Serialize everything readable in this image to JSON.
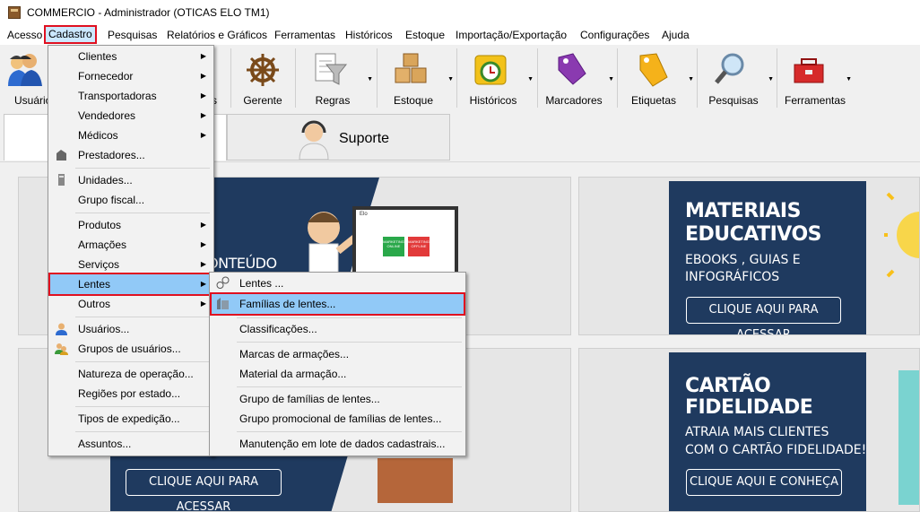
{
  "window": {
    "title": "COMMERCIO - Administrador (OTICAS ELO TM1)"
  },
  "menubar": {
    "items": [
      "Acesso",
      "Cadastro",
      "Pesquisas",
      "Relatórios e Gráficos",
      "Ferramentas",
      "Históricos",
      "Estoque",
      "Importação/Exportação",
      "Configurações",
      "Ajuda"
    ]
  },
  "toolbar": {
    "items": [
      {
        "label": "Usuários",
        "icon": "users-icon"
      },
      {
        "label": "Gerente",
        "icon": "ship-wheel-icon"
      },
      {
        "label": "Regras",
        "icon": "funnel-icon"
      },
      {
        "label": "Estoque",
        "icon": "boxes-icon"
      },
      {
        "label": "Históricos",
        "icon": "history-clock-icon"
      },
      {
        "label": "Marcadores",
        "icon": "tag-icon"
      },
      {
        "label": "Etiquetas",
        "icon": "label-icon"
      },
      {
        "label": "Pesquisas",
        "icon": "magnifier-icon"
      },
      {
        "label": "Ferramentas",
        "icon": "toolbox-icon"
      }
    ],
    "partial_label": "s"
  },
  "tabs": {
    "suporte": "Suporte"
  },
  "cards": {
    "left_top_text": "ONTEÚDO",
    "left_bottom_button": "CLIQUE AQUI PARA ACESSAR",
    "right_top": {
      "title_line1": "MATERIAIS",
      "title_line2": "EDUCATIVOS",
      "sub_line1": "EBOOKS , GUIAS E",
      "sub_line2": "INFOGRÁFICOS",
      "button": "CLIQUE AQUI PARA ACESSAR"
    },
    "right_bottom": {
      "title_line1": "CARTÃO",
      "title_line2": "FIDELIDADE",
      "sub_line1": "ATRAIA MAIS CLIENTES",
      "sub_line2": "COM O CARTÃO FIDELIDADE!",
      "button": "CLIQUE AQUI E CONHEÇA"
    },
    "screen_labels": {
      "brand": "Elo",
      "tile1": "MARKETING ONLINE",
      "tile2": "MARKETING OFFLINE"
    }
  },
  "cadastro_menu": {
    "items": [
      "Clientes",
      "Fornecedor",
      "Transportadoras",
      "Vendedores",
      "Médicos",
      "Prestadores...",
      "Unidades...",
      "Grupo fiscal...",
      "Produtos",
      "Armações",
      "Serviços",
      "Lentes",
      "Outros",
      "Usuários...",
      "Grupos de usuários...",
      "Natureza de operação...",
      "Regiões por estado...",
      "Tipos de expedição...",
      "Assuntos..."
    ]
  },
  "lentes_menu": {
    "items": [
      "Lentes ...",
      "Famílias de lentes...",
      "Classificações...",
      "Marcas de armações...",
      "Material da armação...",
      "Grupo de famílias de lentes...",
      "Grupo promocional de famílias de lentes...",
      "Manutenção em lote de dados cadastrais..."
    ]
  },
  "colors": {
    "banner": "#1f3a5f",
    "highlight": "#91c9f7",
    "red_outline": "#e01020"
  }
}
